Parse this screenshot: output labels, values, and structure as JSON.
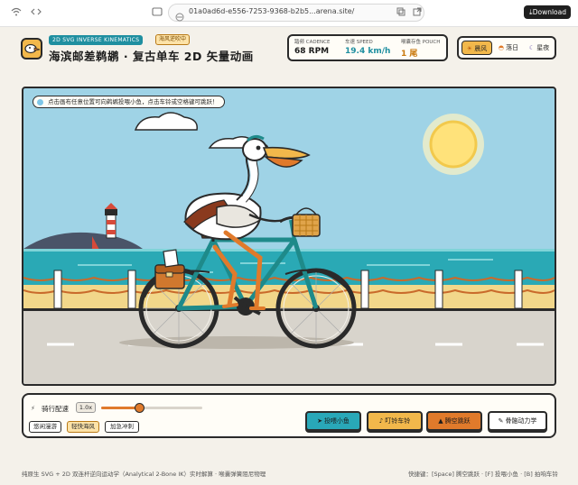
{
  "browser": {
    "url": "01a0ad6d-e556-7253-9368-b2b5...arena.site/",
    "download_label": "Download"
  },
  "header": {
    "kinematics_tag": "2D SVG INVERSE KINEMATICS",
    "status_tag": "海风逆吹中",
    "title": "海滨邮差鹈鹕 · 复古单车 2D 矢量动画",
    "stats": [
      {
        "label": "踏频 CADENCE",
        "value": "68 RPM",
        "color": "#1c1c1c"
      },
      {
        "label": "车速 SPEED",
        "value": "19.4 km/h",
        "color": "#1f8fa0"
      },
      {
        "label": "喉囊存鱼 POUCH",
        "value": "1 尾",
        "color": "#c9780c"
      }
    ],
    "weather": [
      {
        "label": "晨风",
        "icon": "sun-icon",
        "active": true
      },
      {
        "label": "落日",
        "icon": "sunset-icon",
        "active": false
      },
      {
        "label": "星夜",
        "icon": "moon-icon",
        "active": false
      }
    ]
  },
  "scene": {
    "hint": "点击画布任意位置可向鹈鹕投喂小鱼，点击车铃或空格键可跳跃！"
  },
  "controls": {
    "pace_label": "骑行配速",
    "pace_value": "1.0x",
    "pace_level": 0.38,
    "presets": [
      "悠闲漫游",
      "轻快海风",
      "加急冲刺"
    ],
    "active_preset": 1,
    "actions": [
      {
        "label": "投喂小鱼",
        "icon": "fish-icon",
        "bg": "#29a8b8"
      },
      {
        "label": "叮铃车铃",
        "icon": "bell-icon",
        "bg": "#f2b84b"
      },
      {
        "label": "腾空跳跃",
        "icon": "jump-icon",
        "bg": "#e07a2b"
      },
      {
        "label": "骨骼动力学",
        "icon": "bone-icon",
        "bg": "#ffffff"
      }
    ]
  },
  "footer": {
    "left": "纯原生 SVG + 2D 双连杆逆向运动学（Analytical 2-Bone IK）实时解算 · 喉囊弹簧阻尼物理",
    "right": "快捷键：[Space] 腾空跳跃 · [F] 投喂小鱼 · [B] 拍响车铃"
  },
  "colors": {
    "sky": "#9fd3e6",
    "sea": "#2aa9b5",
    "road": "#d8d4cc",
    "frame": "#1e8a8a",
    "accent": "#e07a2b"
  }
}
